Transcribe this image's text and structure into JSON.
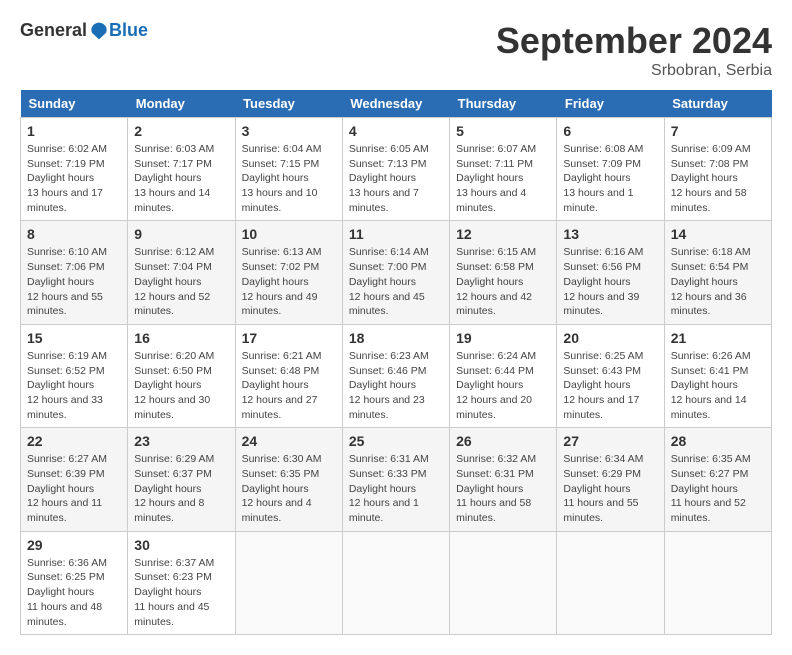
{
  "logo": {
    "general": "General",
    "blue": "Blue"
  },
  "title": {
    "month": "September 2024",
    "location": "Srbobran, Serbia"
  },
  "days_of_week": [
    "Sunday",
    "Monday",
    "Tuesday",
    "Wednesday",
    "Thursday",
    "Friday",
    "Saturday"
  ],
  "weeks": [
    [
      {
        "day": "1",
        "sunrise": "6:02 AM",
        "sunset": "7:19 PM",
        "daylight": "13 hours and 17 minutes."
      },
      {
        "day": "2",
        "sunrise": "6:03 AM",
        "sunset": "7:17 PM",
        "daylight": "13 hours and 14 minutes."
      },
      {
        "day": "3",
        "sunrise": "6:04 AM",
        "sunset": "7:15 PM",
        "daylight": "13 hours and 10 minutes."
      },
      {
        "day": "4",
        "sunrise": "6:05 AM",
        "sunset": "7:13 PM",
        "daylight": "13 hours and 7 minutes."
      },
      {
        "day": "5",
        "sunrise": "6:07 AM",
        "sunset": "7:11 PM",
        "daylight": "13 hours and 4 minutes."
      },
      {
        "day": "6",
        "sunrise": "6:08 AM",
        "sunset": "7:09 PM",
        "daylight": "13 hours and 1 minute."
      },
      {
        "day": "7",
        "sunrise": "6:09 AM",
        "sunset": "7:08 PM",
        "daylight": "12 hours and 58 minutes."
      }
    ],
    [
      {
        "day": "8",
        "sunrise": "6:10 AM",
        "sunset": "7:06 PM",
        "daylight": "12 hours and 55 minutes."
      },
      {
        "day": "9",
        "sunrise": "6:12 AM",
        "sunset": "7:04 PM",
        "daylight": "12 hours and 52 minutes."
      },
      {
        "day": "10",
        "sunrise": "6:13 AM",
        "sunset": "7:02 PM",
        "daylight": "12 hours and 49 minutes."
      },
      {
        "day": "11",
        "sunrise": "6:14 AM",
        "sunset": "7:00 PM",
        "daylight": "12 hours and 45 minutes."
      },
      {
        "day": "12",
        "sunrise": "6:15 AM",
        "sunset": "6:58 PM",
        "daylight": "12 hours and 42 minutes."
      },
      {
        "day": "13",
        "sunrise": "6:16 AM",
        "sunset": "6:56 PM",
        "daylight": "12 hours and 39 minutes."
      },
      {
        "day": "14",
        "sunrise": "6:18 AM",
        "sunset": "6:54 PM",
        "daylight": "12 hours and 36 minutes."
      }
    ],
    [
      {
        "day": "15",
        "sunrise": "6:19 AM",
        "sunset": "6:52 PM",
        "daylight": "12 hours and 33 minutes."
      },
      {
        "day": "16",
        "sunrise": "6:20 AM",
        "sunset": "6:50 PM",
        "daylight": "12 hours and 30 minutes."
      },
      {
        "day": "17",
        "sunrise": "6:21 AM",
        "sunset": "6:48 PM",
        "daylight": "12 hours and 27 minutes."
      },
      {
        "day": "18",
        "sunrise": "6:23 AM",
        "sunset": "6:46 PM",
        "daylight": "12 hours and 23 minutes."
      },
      {
        "day": "19",
        "sunrise": "6:24 AM",
        "sunset": "6:44 PM",
        "daylight": "12 hours and 20 minutes."
      },
      {
        "day": "20",
        "sunrise": "6:25 AM",
        "sunset": "6:43 PM",
        "daylight": "12 hours and 17 minutes."
      },
      {
        "day": "21",
        "sunrise": "6:26 AM",
        "sunset": "6:41 PM",
        "daylight": "12 hours and 14 minutes."
      }
    ],
    [
      {
        "day": "22",
        "sunrise": "6:27 AM",
        "sunset": "6:39 PM",
        "daylight": "12 hours and 11 minutes."
      },
      {
        "day": "23",
        "sunrise": "6:29 AM",
        "sunset": "6:37 PM",
        "daylight": "12 hours and 8 minutes."
      },
      {
        "day": "24",
        "sunrise": "6:30 AM",
        "sunset": "6:35 PM",
        "daylight": "12 hours and 4 minutes."
      },
      {
        "day": "25",
        "sunrise": "6:31 AM",
        "sunset": "6:33 PM",
        "daylight": "12 hours and 1 minute."
      },
      {
        "day": "26",
        "sunrise": "6:32 AM",
        "sunset": "6:31 PM",
        "daylight": "11 hours and 58 minutes."
      },
      {
        "day": "27",
        "sunrise": "6:34 AM",
        "sunset": "6:29 PM",
        "daylight": "11 hours and 55 minutes."
      },
      {
        "day": "28",
        "sunrise": "6:35 AM",
        "sunset": "6:27 PM",
        "daylight": "11 hours and 52 minutes."
      }
    ],
    [
      {
        "day": "29",
        "sunrise": "6:36 AM",
        "sunset": "6:25 PM",
        "daylight": "11 hours and 48 minutes."
      },
      {
        "day": "30",
        "sunrise": "6:37 AM",
        "sunset": "6:23 PM",
        "daylight": "11 hours and 45 minutes."
      },
      null,
      null,
      null,
      null,
      null
    ]
  ]
}
